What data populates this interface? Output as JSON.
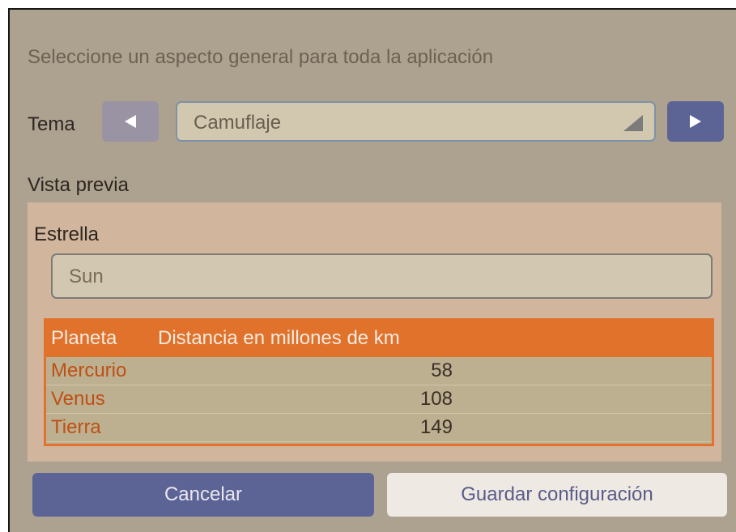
{
  "dialog": {
    "subtitle": "Seleccione un aspecto general para toda la aplicación",
    "theme": {
      "label": "Tema",
      "selected_value": "Camuflaje"
    },
    "preview": {
      "label": "Vista previa",
      "star_label": "Estrella",
      "star_value": "Sun",
      "table": {
        "columns": [
          "Planeta",
          "Distancia en millones de km"
        ],
        "rows": [
          {
            "name": "Mercurio",
            "distance": "58"
          },
          {
            "name": "Venus",
            "distance": "108"
          },
          {
            "name": "Tierra",
            "distance": "149"
          }
        ]
      }
    },
    "buttons": {
      "cancel": "Cancelar",
      "save": "Guardar configuración"
    }
  },
  "colors": {
    "panel_bg": "#ada290",
    "accent_blue": "#5c6496",
    "table_orange": "#e0722b",
    "preview_bg": "#d1b59c"
  },
  "icons": {
    "previous": "triangle-left-icon",
    "next": "triangle-right-icon",
    "dropdown": "dropdown-triangle-icon"
  }
}
